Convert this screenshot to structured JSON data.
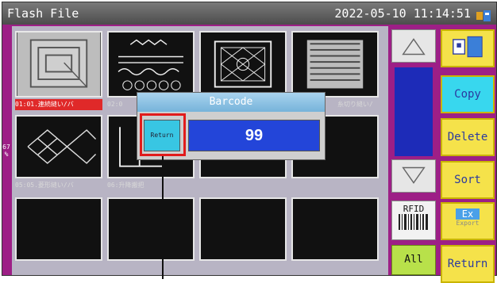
{
  "header": {
    "title": "Flash File",
    "datetime": "2022-05-10 11:14:51",
    "status_icon": "usb-drive-icon"
  },
  "left_strip": {
    "label": "67 %"
  },
  "files": [
    {
      "caption": "01:01.連続縫い/バ",
      "pattern": "nested-rectangles",
      "selected": true
    },
    {
      "caption": "02:0",
      "pattern": "wave-rows",
      "selected": false
    },
    {
      "caption": "",
      "pattern": "diamond-panel",
      "selected": false
    },
    {
      "caption": "糸切り縫い/",
      "pattern": "dot-grid",
      "selected": false
    },
    {
      "caption": "05:05.菱形縫い/バ",
      "pattern": "diamond-mesh",
      "selected": false
    },
    {
      "caption": "06:升降搬把",
      "pattern": "step-outline",
      "selected": false
    },
    {
      "caption": "",
      "pattern": "empty",
      "selected": false
    },
    {
      "caption": "",
      "pattern": "empty",
      "selected": false
    },
    {
      "caption": "",
      "pattern": "empty",
      "selected": false
    },
    {
      "caption": "",
      "pattern": "empty",
      "selected": false
    },
    {
      "caption": "",
      "pattern": "empty",
      "selected": false
    },
    {
      "caption": "",
      "pattern": "empty",
      "selected": false
    }
  ],
  "scroll": {
    "up_icon": "triangle-up-icon",
    "down_icon": "triangle-down-icon"
  },
  "rfid": {
    "label": "RFID"
  },
  "all": {
    "label": "All"
  },
  "side_buttons": {
    "usb": {
      "icon": "usb-card-icon"
    },
    "copy": "Copy",
    "delete": "Delete",
    "sort": "Sort",
    "export_top": "Ex",
    "export_bottom": "Export",
    "return": "Return"
  },
  "dialog": {
    "title": "Barcode",
    "return_label": "Return",
    "value": "99"
  },
  "colors": {
    "accent_blue": "#2345d9",
    "button_yellow": "#f5e24a",
    "button_cyan": "#38d7ee",
    "highlight_red": "#e11b1b"
  }
}
